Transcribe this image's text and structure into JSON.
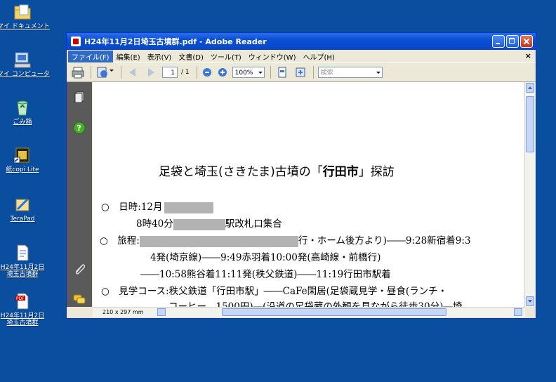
{
  "desktop": {
    "icons": [
      {
        "label": "マイ ドキュメント",
        "icon": "folder-icon"
      },
      {
        "label": "マイ コンピュータ",
        "icon": "computer-icon"
      },
      {
        "label": "ごみ箱",
        "icon": "recycle-bin-icon"
      },
      {
        "label": "紙copi Lite",
        "icon": "app-icon"
      },
      {
        "label": "TeraPad",
        "icon": "text-editor-icon"
      },
      {
        "label": "H24年11月2日\n埼玉古墳群",
        "icon": "document-icon"
      },
      {
        "label": "H24年11月2日\n埼玉古墳群",
        "icon": "pdf-icon"
      }
    ]
  },
  "window": {
    "title": "H24年11月2日埼玉古墳群.pdf - Adobe Reader",
    "menu": [
      "ファイル(F)",
      "編集(E)",
      "表示(V)",
      "文書(D)",
      "ツール(T)",
      "ウィンドウ(W)",
      "ヘルプ(H)"
    ],
    "menu_close": "×",
    "toolbar": {
      "page_current": "1",
      "page_total": "/ 1",
      "zoom": "100%",
      "search_placeholder": "検索"
    },
    "page_size": "210 x 297 mm"
  },
  "document": {
    "title_prefix": "足袋と埼玉(さきたま)古墳の「",
    "title_bold": "行田市",
    "title_suffix": "」探訪",
    "lines": [
      "○　日時:12月",
      "8時40分",
      "駅改札口集合",
      "○　旅程:",
      "行・ホーム後方より)――9:28新宿着9:3",
      "4発(埼京線)――9:49赤羽着10:00発(高崎線・前橋行)",
      "――10:58熊谷着11:11発(秩父鉄道)――11:19行田市駅着",
      "○　見学コース:秩父鉄道「行田市駅」――CaFe閑居(足袋蔵見学・昼食(ランチ・",
      "コーヒー　1500円)―(沿道の足袋蔵の外観を見ながら徒歩30分)―埼"
    ]
  },
  "colors": {
    "desktop": "#0a4ea0",
    "titlebar": "#0a4fd4",
    "redaction": "#b3b3b3"
  }
}
